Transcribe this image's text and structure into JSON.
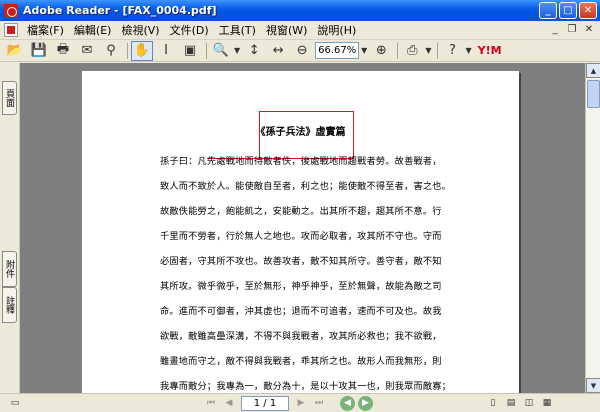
{
  "window": {
    "title": "Adobe Reader - [FAX_0004.pdf]",
    "controls": {
      "minimize": "_",
      "maximize": "□",
      "close": "✕"
    }
  },
  "menubar": {
    "items": [
      "檔案(F)",
      "編輯(E)",
      "檢視(V)",
      "文件(D)",
      "工具(T)",
      "視窗(W)",
      "說明(H)"
    ],
    "right": {
      "minimize": "_",
      "restore": "❐",
      "close": "✕"
    }
  },
  "toolbar": {
    "zoom_value": "66.67%",
    "brand": "Y!M"
  },
  "left_tabs": {
    "pages": "頁面",
    "attachments": "附件",
    "comments": "註釋"
  },
  "document": {
    "title": "《孫子兵法》虛實篇",
    "lines": [
      "孫子曰：凡先處戰地而待敵者佚，後處戰地而趨戰者勞。故善戰者，",
      "致人而不致於人。能使敵自至者，利之也；能使敵不得至者，害之也。",
      "故敵佚能勞之，飽能飢之，安能動之。出其所不趨，趨其所不意。行",
      "千里而不勞者，行於無人之地也。攻而必取者，攻其所不守也。守而",
      "必固者，守其所不攻也。故善攻者，敵不知其所守。善守者，敵不知",
      "其所攻。微乎微乎，至於無形，神乎神乎，至於無聲，故能為敵之司",
      "命。進而不可御者，沖其虛也；退而不可追者，速而不可及也。故我",
      "欲戰，敵雖高壘深溝，不得不與我戰者，攻其所必救也；我不欲戰，",
      "雖畫地而守之，敵不得與我戰者，乖其所之也。故形人而我無形，則",
      "我專而敵分；我專為一，敵分為十，是以十攻其一也，則我眾而敵寡；"
    ]
  },
  "statusbar": {
    "page_indicator": "1 / 1"
  }
}
